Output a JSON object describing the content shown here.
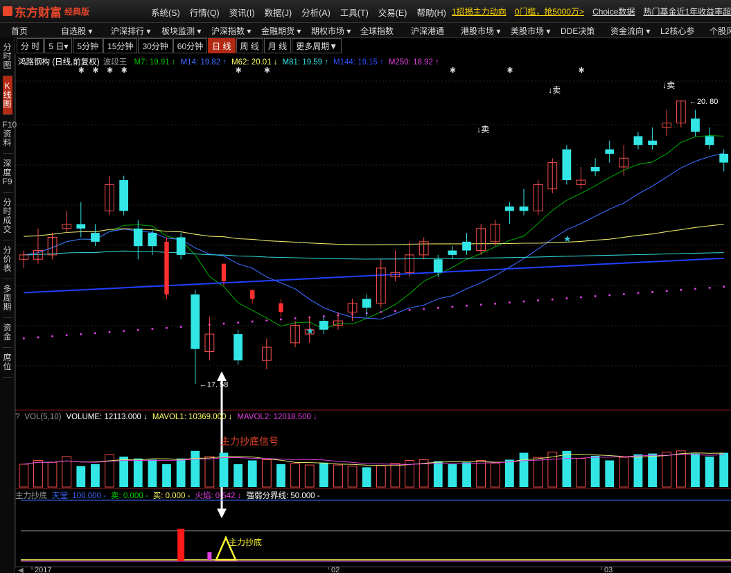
{
  "topbar": {
    "logo_text": "东方财富",
    "logo_sub": "经典版",
    "menu": [
      "系统(S)",
      "行情(Q)",
      "资讯(I)",
      "数据(J)",
      "分析(A)",
      "工具(T)",
      "交易(E)",
      "帮助(H)"
    ],
    "ticker": [
      {
        "text": "1招揭主力动向",
        "color": "#ffd700"
      },
      {
        "text": "0门槛，抢5000万>",
        "color": "#ffd700"
      },
      {
        "text": "Choice数据",
        "color": "#ddd"
      },
      {
        "text": "热门基金近1年收益率超60",
        "color": "#ddd"
      }
    ]
  },
  "navbar": [
    "首页",
    "自选股 ▾",
    "沪深排行 ▾",
    "板块监测 ▾",
    "沪深指数 ▾",
    "金融期货 ▾",
    "期权市场 ▾",
    "全球指数",
    "沪深港通",
    "港股市场 ▾",
    "美股市场 ▾",
    "DDE决策",
    "资金流向 ▾",
    "L2核心参",
    "个股风"
  ],
  "sidebar": [
    "分时图",
    "K线图",
    "F10资料",
    "深度F9",
    "分时成交",
    "分价表",
    "多周期",
    "资金",
    "席位"
  ],
  "tabs": [
    "分 时",
    "5 日▾",
    "5分钟",
    "15分钟",
    "30分钟",
    "60分钟",
    "日 线",
    "周 线",
    "月 线",
    "更多周期▼"
  ],
  "legend": {
    "name": "鸿路钢构 (日线,前复权)",
    "indicator": "波段王",
    "ma": [
      {
        "label": "M7: 19.91 ↑",
        "color": "#00c000"
      },
      {
        "label": "M14: 19.82 ↑",
        "color": "#3b6cff"
      },
      {
        "label": "M62: 20.01 ↓",
        "color": "#ffff66"
      },
      {
        "label": "M81: 19.59 ↑",
        "color": "#33e0e0"
      },
      {
        "label": "M144: 19.15 ↑",
        "color": "#3050ff"
      },
      {
        "label": "M250: 18.92 ↑",
        "color": "#e040e0"
      }
    ]
  },
  "annotations": {
    "high": "20. 80",
    "low": "17. 58",
    "sell": "↓卖",
    "signal_label": "主力抄底信号",
    "bottom_label": "主力抄底"
  },
  "vol_legend": [
    {
      "text": "?",
      "color": "#999"
    },
    {
      "text": "VOL(5,10)",
      "color": "#999"
    },
    {
      "text": "VOLUME: 12113.000 ↓",
      "color": "#fff"
    },
    {
      "text": "MAVOL1: 10369.000 ↓",
      "color": "#ffff66"
    },
    {
      "text": "MAVOL2: 12018.500 ↓",
      "color": "#e040e0"
    }
  ],
  "sig_legend": [
    {
      "text": "主力抄底",
      "color": "#999"
    },
    {
      "text": "天堂: 100.000 -",
      "color": "#3b6cff"
    },
    {
      "text": "卖: 0.000 -",
      "color": "#00d000"
    },
    {
      "text": "买: 0.000 -",
      "color": "#ffff66"
    },
    {
      "text": "火焰: 0.542 ↓",
      "color": "#e040e0"
    },
    {
      "text": "强弱分界线: 50.000 -",
      "color": "#fff"
    }
  ],
  "xaxis": [
    "2017",
    "02",
    "03"
  ],
  "chart_data": {
    "type": "candlestick",
    "title": "鸿路钢构 (日线,前复权)",
    "candles": [
      {
        "o": 19.0,
        "c": 19.05,
        "h": 19.1,
        "l": 18.9
      },
      {
        "o": 19.0,
        "c": 19.1,
        "h": 19.35,
        "l": 18.95
      },
      {
        "o": 19.05,
        "c": 19.25,
        "h": 19.3,
        "l": 19.0
      },
      {
        "o": 19.35,
        "c": 19.4,
        "h": 19.55,
        "l": 19.3
      },
      {
        "o": 19.4,
        "c": 19.35,
        "h": 19.65,
        "l": 19.25
      },
      {
        "o": 19.3,
        "c": 19.2,
        "h": 19.4,
        "l": 19.15
      },
      {
        "o": 19.55,
        "c": 19.85,
        "h": 19.95,
        "l": 19.5
      },
      {
        "o": 19.9,
        "c": 19.55,
        "h": 19.95,
        "l": 19.5
      },
      {
        "o": 19.35,
        "c": 19.15,
        "h": 19.45,
        "l": 19.0
      },
      {
        "o": 19.3,
        "c": 19.15,
        "h": 19.35,
        "l": 19.05
      },
      {
        "o": 19.2,
        "c": 18.6,
        "h": 19.25,
        "l": 18.55
      },
      {
        "o": 19.25,
        "c": 19.05,
        "h": 19.3,
        "l": 19.0
      },
      {
        "o": 18.6,
        "c": 17.98,
        "h": 18.65,
        "l": 17.58
      },
      {
        "o": 17.95,
        "c": 18.15,
        "h": 18.35,
        "l": 17.85
      },
      {
        "o": 18.95,
        "c": 18.75,
        "h": 18.95,
        "l": 18.7
      },
      {
        "o": 18.15,
        "c": 17.85,
        "h": 18.2,
        "l": 17.8
      },
      {
        "o": 18.65,
        "c": 18.55,
        "h": 18.65,
        "l": 18.5
      },
      {
        "o": 17.85,
        "c": 18.0,
        "h": 18.1,
        "l": 17.75
      },
      {
        "o": 18.5,
        "c": 18.4,
        "h": 18.55,
        "l": 18.35
      },
      {
        "o": 18.05,
        "c": 18.25,
        "h": 18.3,
        "l": 18.0
      },
      {
        "o": 18.15,
        "c": 18.2,
        "h": 18.35,
        "l": 18.05
      },
      {
        "o": 18.3,
        "c": 18.2,
        "h": 18.35,
        "l": 18.15
      },
      {
        "o": 18.25,
        "c": 18.3,
        "h": 18.4,
        "l": 18.2
      },
      {
        "o": 18.4,
        "c": 18.5,
        "h": 18.55,
        "l": 18.3
      },
      {
        "o": 18.55,
        "c": 18.45,
        "h": 18.6,
        "l": 18.35
      },
      {
        "o": 18.5,
        "c": 18.9,
        "h": 19.0,
        "l": 18.45
      },
      {
        "o": 18.8,
        "c": 18.85,
        "h": 19.1,
        "l": 18.75
      },
      {
        "o": 18.85,
        "c": 19.05,
        "h": 19.2,
        "l": 18.8
      },
      {
        "o": 19.05,
        "c": 19.2,
        "h": 19.25,
        "l": 19.0
      },
      {
        "o": 19.0,
        "c": 18.85,
        "h": 19.05,
        "l": 18.8
      },
      {
        "o": 19.1,
        "c": 19.05,
        "h": 19.15,
        "l": 19.0
      },
      {
        "o": 19.2,
        "c": 19.1,
        "h": 19.3,
        "l": 19.05
      },
      {
        "o": 19.1,
        "c": 19.35,
        "h": 19.4,
        "l": 19.05
      },
      {
        "o": 19.2,
        "c": 19.4,
        "h": 19.45,
        "l": 19.15
      },
      {
        "o": 19.6,
        "c": 19.55,
        "h": 19.65,
        "l": 19.4
      },
      {
        "o": 19.6,
        "c": 19.55,
        "h": 19.8,
        "l": 19.5
      },
      {
        "o": 19.55,
        "c": 19.85,
        "h": 19.9,
        "l": 19.5
      },
      {
        "o": 19.8,
        "c": 20.1,
        "h": 20.15,
        "l": 19.75
      },
      {
        "o": 20.25,
        "c": 19.9,
        "h": 20.3,
        "l": 19.85
      },
      {
        "o": 19.85,
        "c": 19.9,
        "h": 20.05,
        "l": 19.8
      },
      {
        "o": 20.05,
        "c": 20.0,
        "h": 20.15,
        "l": 19.95
      },
      {
        "o": 20.25,
        "c": 20.2,
        "h": 20.35,
        "l": 20.1
      },
      {
        "o": 20.05,
        "c": 20.15,
        "h": 20.3,
        "l": 19.95
      },
      {
        "o": 20.4,
        "c": 20.3,
        "h": 20.45,
        "l": 20.25
      },
      {
        "o": 20.35,
        "c": 20.3,
        "h": 20.5,
        "l": 20.25
      },
      {
        "o": 20.5,
        "c": 20.55,
        "h": 20.7,
        "l": 20.4
      },
      {
        "o": 20.55,
        "c": 20.8,
        "h": 20.8,
        "l": 20.5
      },
      {
        "o": 20.6,
        "c": 20.45,
        "h": 20.7,
        "l": 20.4
      },
      {
        "o": 20.4,
        "c": 20.3,
        "h": 20.5,
        "l": 20.25
      },
      {
        "o": 20.2,
        "c": 20.1,
        "h": 20.25,
        "l": 20.0
      }
    ],
    "volume": [
      60,
      70,
      65,
      80,
      55,
      60,
      85,
      80,
      75,
      72,
      60,
      75,
      95,
      80,
      90,
      60,
      70,
      72,
      60,
      62,
      58,
      64,
      58,
      55,
      52,
      56,
      62,
      70,
      72,
      68,
      60,
      65,
      70,
      63,
      72,
      90,
      78,
      92,
      95,
      75,
      82,
      70,
      78,
      86,
      88,
      92,
      95,
      88,
      80,
      90
    ],
    "signal_bars": [
      0,
      0,
      0,
      0,
      0,
      0,
      0,
      0,
      0,
      0,
      0,
      85,
      0,
      0,
      0,
      0,
      0,
      0,
      0,
      0,
      0,
      0,
      0,
      0,
      0,
      0,
      0,
      0,
      0,
      0,
      0,
      0,
      0,
      0,
      0,
      0,
      0,
      0,
      0,
      0,
      0,
      0,
      0,
      0,
      0,
      0,
      0,
      0,
      0,
      0
    ]
  }
}
